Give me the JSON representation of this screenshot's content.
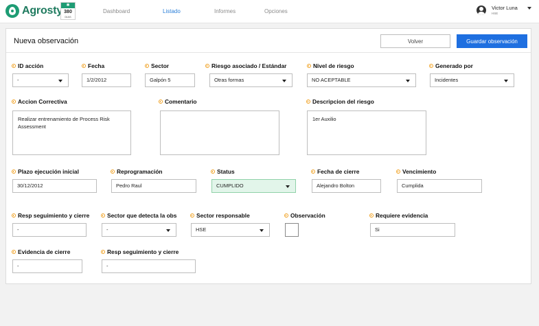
{
  "brand": {
    "name": "Agrosty",
    "badge_number": "380",
    "badge_unit": "DIAS"
  },
  "nav": {
    "items": [
      "Dashboard",
      "Listado",
      "Informes",
      "Opciones"
    ],
    "active": "Listado"
  },
  "user": {
    "name": "Victor Luna",
    "role": "HSE"
  },
  "page": {
    "title": "Nueva observación",
    "back_label": "Volver",
    "save_label": "Guardar observación"
  },
  "colors": {
    "accent": "#1e6fe0",
    "brand": "#1e9c74",
    "required": "#f0a020",
    "status_bg": "#e2f5ea"
  },
  "fields": {
    "id_accion": {
      "label": "ID acción",
      "value": "-"
    },
    "fecha": {
      "label": "Fecha",
      "value": "1/2/2012"
    },
    "sector": {
      "label": "Sector",
      "value": "Galpón 5"
    },
    "riesgo_asociado": {
      "label": "Riesgo asociado / Estándar",
      "value": "Otras formas"
    },
    "nivel_riesgo": {
      "label": "Nivel de riesgo",
      "value": "NO ACEPTABLE"
    },
    "generado_por": {
      "label": "Generado por",
      "value": "Incidentes"
    },
    "accion_correctiva": {
      "label": "Accion Correctiva",
      "value": "Realizar entrenamiento de Process Risk Assessment"
    },
    "comentario": {
      "label": "Comentario",
      "value": ""
    },
    "descripcion_riesgo": {
      "label": "Descripcion del riesgo",
      "value": "1er  Auxilio"
    },
    "plazo_ejecucion": {
      "label": "Plazo ejecución inicial",
      "value": "30/12/2012"
    },
    "reprogramacion": {
      "label": "Reprogramación",
      "value": "Pedro Raul"
    },
    "status": {
      "label": "Status",
      "value": "CUMPLIDO"
    },
    "fecha_cierre": {
      "label": "Fecha de cierre",
      "value": "Alejandro Bolton"
    },
    "vencimiento": {
      "label": "Vencimiento",
      "value": "Cumplida"
    },
    "resp_seguimiento": {
      "label": "Resp seguimiento y cierre",
      "value": "-"
    },
    "sector_detecta": {
      "label": "Sector que detecta la obs",
      "value": "-"
    },
    "sector_responsable": {
      "label": "Sector responsable",
      "value": "HSE"
    },
    "observacion": {
      "label": "Observación",
      "checked": false
    },
    "requiere_evidencia": {
      "label": "Requiere evidencia",
      "value": "Si"
    },
    "evidencia_cierre": {
      "label": "Evidencia de cierre",
      "value": "-"
    },
    "resp_seguimiento_2": {
      "label": "Resp seguimiento y  cierre",
      "value": "-"
    }
  }
}
